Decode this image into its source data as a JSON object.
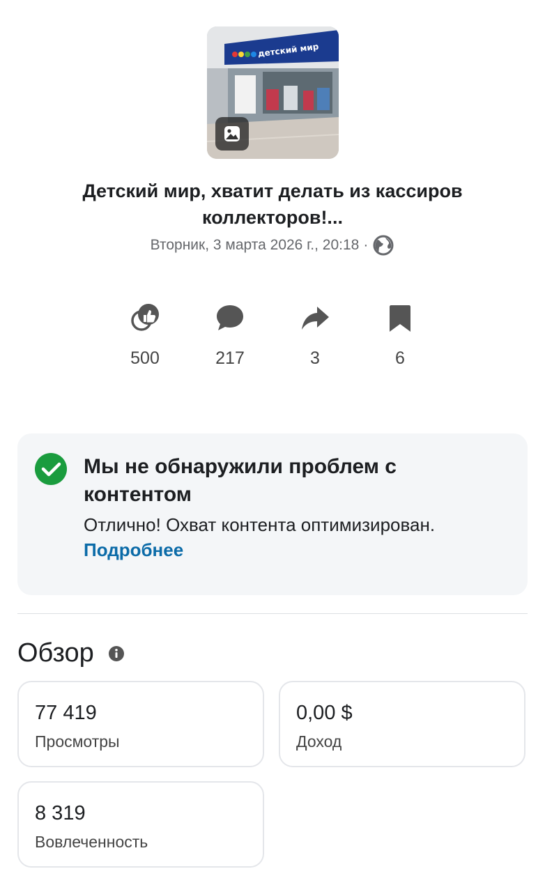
{
  "post": {
    "thumbnail_sign": "детский мир",
    "title": "Детский мир, хватит делать из кассиров коллекторов!...",
    "date": "Вторник, 3 марта 2026 г., 20:18",
    "separator": "·",
    "privacy_icon": "globe-icon"
  },
  "stats": [
    {
      "icon": "reactions-icon",
      "value": "500"
    },
    {
      "icon": "comment-icon",
      "value": "217"
    },
    {
      "icon": "share-icon",
      "value": "3"
    },
    {
      "icon": "bookmark-icon",
      "value": "6"
    }
  ],
  "notice": {
    "icon": "check-circle-icon",
    "title": "Мы не обнаружили проблем с контентом",
    "body": "Отлично! Охват контента оптимизирован.",
    "link": "Подробнее",
    "status_color": "#1a9c3e"
  },
  "overview": {
    "title": "Обзор",
    "info_icon": "info-icon",
    "cards": [
      {
        "value": "77 419",
        "label": "Просмотры"
      },
      {
        "value": "0,00 $",
        "label": "Доход"
      },
      {
        "value": "8 319",
        "label": "Вовлеченность"
      }
    ]
  },
  "colors": {
    "link": "#0b6ba8",
    "notice_bg": "#f4f6f8"
  }
}
